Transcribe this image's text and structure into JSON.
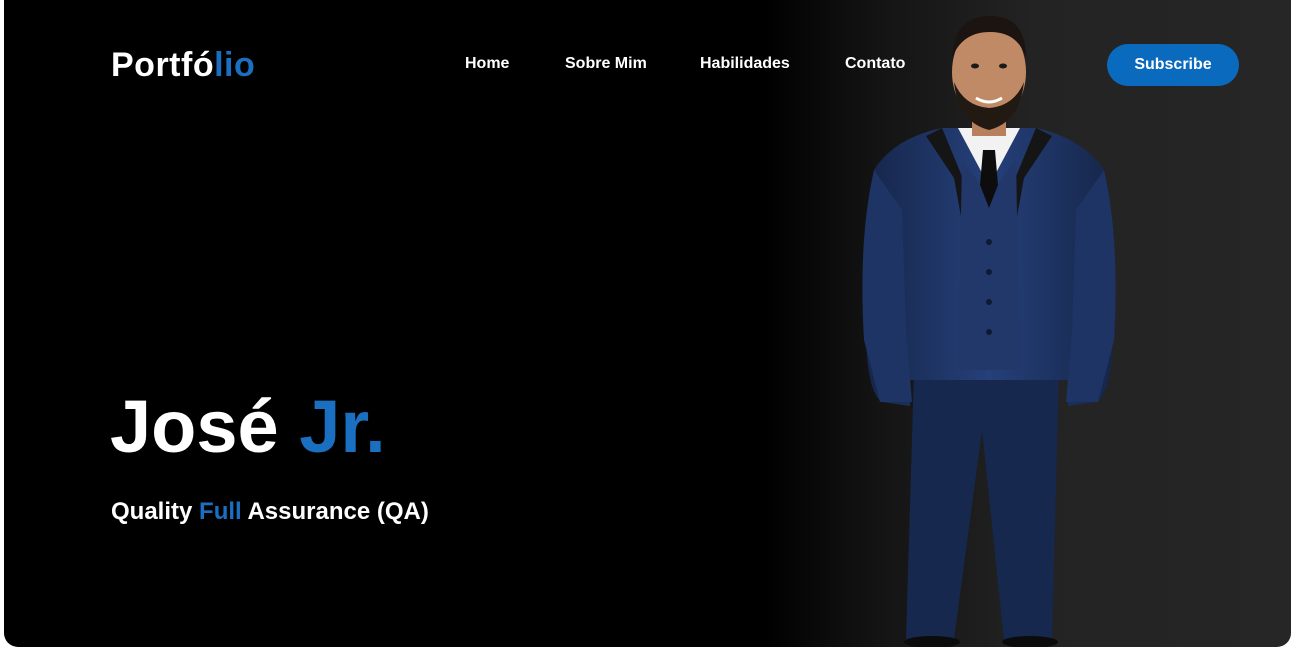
{
  "header": {
    "logo": {
      "part1": "Portfó",
      "part2": "lio"
    },
    "nav": [
      {
        "label": "Home"
      },
      {
        "label": "Sobre Mim"
      },
      {
        "label": "Habilidades"
      },
      {
        "label": "Contato"
      }
    ],
    "subscribe_label": "Subscribe"
  },
  "hero": {
    "name_first": "José",
    "name_accent": "Jr.",
    "role_part1": "Quality ",
    "role_accent": "Full",
    "role_part2": " Assurance (QA)"
  },
  "colors": {
    "accent": "#1b6fc0",
    "button": "#0a6abd",
    "background": "#000000",
    "suit": "#1e3460"
  }
}
